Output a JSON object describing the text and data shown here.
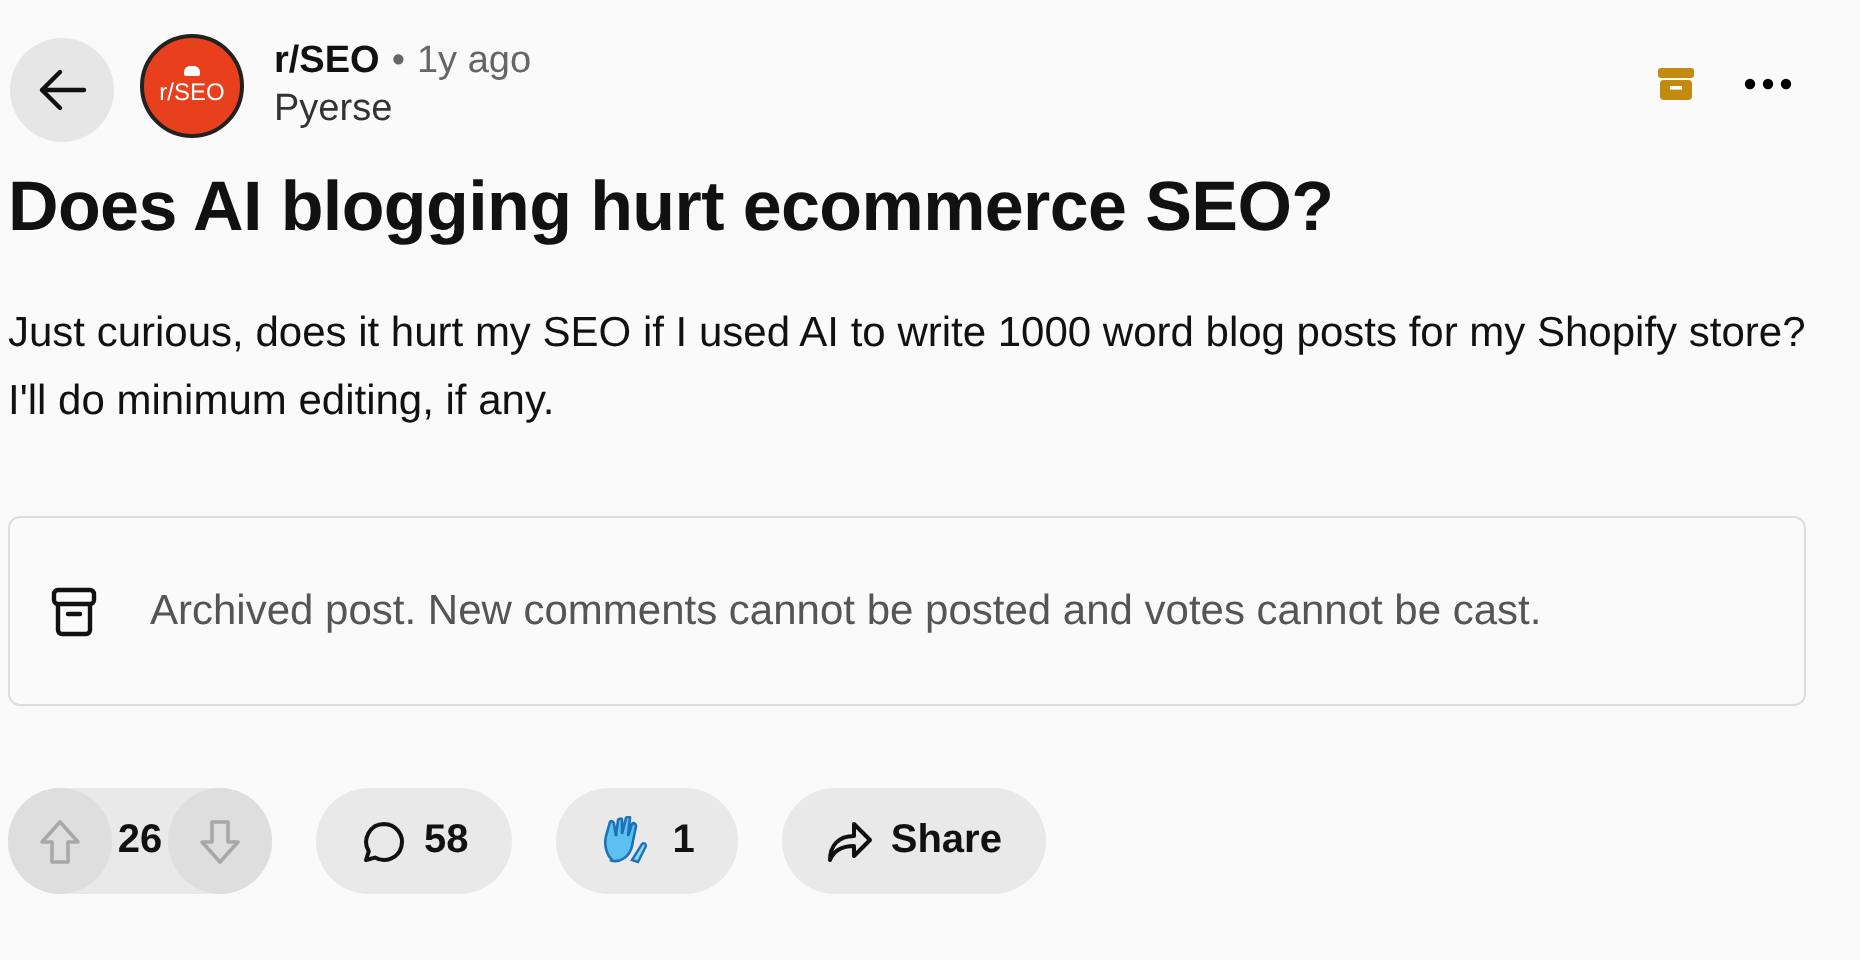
{
  "post": {
    "community": "r/SEO",
    "avatar_label": "r/SEO",
    "separator": "•",
    "age": "1y ago",
    "author": "Pyerse",
    "title": "Does AI blogging hurt ecommerce SEO?",
    "body": "Just curious, does it hurt my SEO if I used AI to write 1000 word blog posts for my Shopify store? I'll do minimum editing, if any."
  },
  "notice": {
    "text": "Archived post. New comments cannot be posted and votes cannot be cast."
  },
  "actions": {
    "votes": {
      "count": "26",
      "disabled": true
    },
    "comments": "58",
    "awards": "1",
    "share": "Share"
  }
}
